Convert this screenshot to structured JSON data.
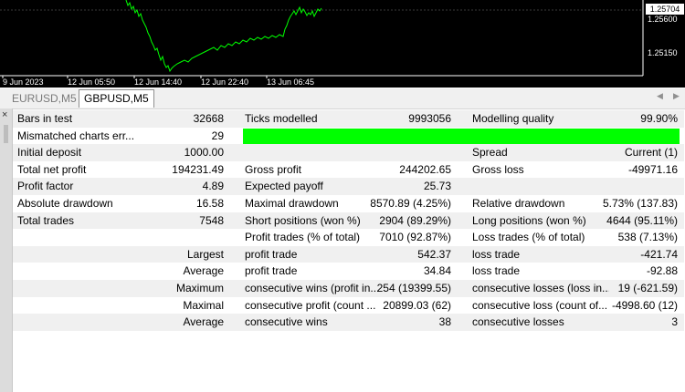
{
  "chart": {
    "price_labels": [
      "1.25704",
      "1.25600",
      "1.25150"
    ],
    "time_labels": [
      "9 Jun 2023",
      "12 Jun 05:50",
      "12 Jun 14:40",
      "12 Jun 22:40",
      "13 Jun 06:45"
    ],
    "line_color": "#00ff00",
    "background": "#000000"
  },
  "tabs": [
    {
      "label": "EURUSD,M5",
      "active": false
    },
    {
      "label": "GBPUSD,M5",
      "active": true
    }
  ],
  "side": {
    "close_label": "×"
  },
  "report": {
    "rows": [
      {
        "c1": "Bars in test",
        "c2": "32668",
        "c3": "Ticks modelled",
        "c4": "9993056",
        "c5": "Modelling quality",
        "c6": "99.90%"
      },
      {
        "c1": "Mismatched charts err...",
        "c2": "29",
        "quality_bar": true
      },
      {
        "c1": "Initial deposit",
        "c2": "1000.00",
        "c3": "",
        "c4": "",
        "c5": "Spread",
        "c6": "Current (1)"
      },
      {
        "c1": "Total net profit",
        "c2": "194231.49",
        "c3": "Gross profit",
        "c4": "244202.65",
        "c5": "Gross loss",
        "c6": "-49971.16"
      },
      {
        "c1": "Profit factor",
        "c2": "4.89",
        "c3": "Expected payoff",
        "c4": "25.73",
        "c5": "",
        "c6": ""
      },
      {
        "c1": "Absolute drawdown",
        "c2": "16.58",
        "c3": "Maximal drawdown",
        "c4": "8570.89 (4.25%)",
        "c5": "Relative drawdown",
        "c6": "5.73% (137.83)"
      },
      {
        "c1": "Total trades",
        "c2": "7548",
        "c3": "Short positions (won %)",
        "c4": "2904 (89.29%)",
        "c5": "Long positions (won %)",
        "c6": "4644 (95.11%)"
      },
      {
        "c1": "",
        "c2": "",
        "c3": "Profit trades (% of total)",
        "c4": "7010 (92.87%)",
        "c5": "Loss trades (% of total)",
        "c6": "538 (7.13%)",
        "blank_left": true
      },
      {
        "c1r": "Largest",
        "c3": "profit trade",
        "c4": "542.37",
        "c5": "loss trade",
        "c6": "-421.74"
      },
      {
        "c1r": "Average",
        "c3": "profit trade",
        "c4": "34.84",
        "c5": "loss trade",
        "c6": "-92.88"
      },
      {
        "c1r": "Maximum",
        "c3": "consecutive wins (profit in...",
        "c4": "254 (19399.55)",
        "c5": "consecutive losses (loss in...",
        "c6": "19 (-621.59)"
      },
      {
        "c1r": "Maximal",
        "c3": "consecutive profit (count ...",
        "c4": "20899.03 (62)",
        "c5": "consecutive loss (count of...",
        "c6": "-4998.60 (12)"
      },
      {
        "c1r": "Average",
        "c3": "consecutive wins",
        "c4": "38",
        "c5": "consecutive losses",
        "c6": "3"
      }
    ],
    "quality_color": "#00ff00"
  }
}
